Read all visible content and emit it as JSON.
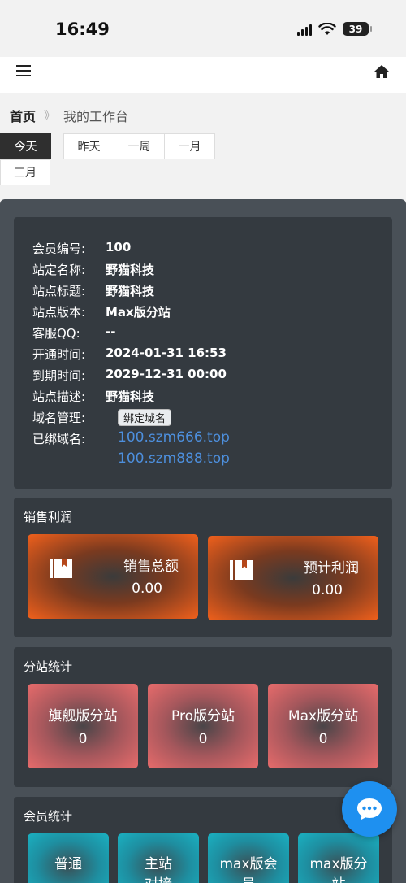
{
  "status_bar": {
    "time": "16:49",
    "battery": "39"
  },
  "breadcrumb": {
    "home": "首页",
    "separator": "》",
    "current": "我的工作台"
  },
  "range_tabs": [
    "今天",
    "昨天",
    "一周",
    "一月",
    "三月"
  ],
  "site_info": {
    "rows": [
      {
        "label": "会员编号:",
        "value": "100"
      },
      {
        "label": "站定名称:",
        "value": "野猫科技"
      },
      {
        "label": "站点标题:",
        "value": "野猫科技"
      },
      {
        "label": "站点版本:",
        "value": "Max版分站"
      },
      {
        "label": "客服QQ:",
        "value": "--"
      },
      {
        "label": "开通时间:",
        "value": "2024-01-31 16:53"
      },
      {
        "label": "到期时间:",
        "value": "2029-12-31 00:00"
      },
      {
        "label": "站点描述:",
        "value": "野猫科技"
      },
      {
        "label": "域名管理:",
        "value": ""
      },
      {
        "label": "已绑域名:",
        "value": ""
      }
    ],
    "bind_button": "绑定域名",
    "domains": [
      "100.szm666.top",
      "100.szm888.top"
    ]
  },
  "sales": {
    "title": "销售利润",
    "cards": [
      {
        "label": "销售总额",
        "value": "0.00"
      },
      {
        "label": "预计利润",
        "value": "0.00"
      }
    ]
  },
  "branches": {
    "title": "分站统计",
    "cards": [
      {
        "label": "旗舰版分站",
        "value": "0"
      },
      {
        "label": "Pro版分站",
        "value": "0"
      },
      {
        "label": "Max版分站",
        "value": "0"
      }
    ]
  },
  "members": {
    "title": "会员统计",
    "cards": [
      {
        "label": "普通"
      },
      {
        "label": "主站对接"
      },
      {
        "label": "max版会员"
      },
      {
        "label": "max版分站"
      }
    ]
  },
  "colors": {
    "accent_link": "#4d8fdd",
    "profit_orange": "#f0601c",
    "branch_red": "#e76b6b",
    "member_teal": "#1ab0c1",
    "chat_blue": "#1e90f0"
  }
}
